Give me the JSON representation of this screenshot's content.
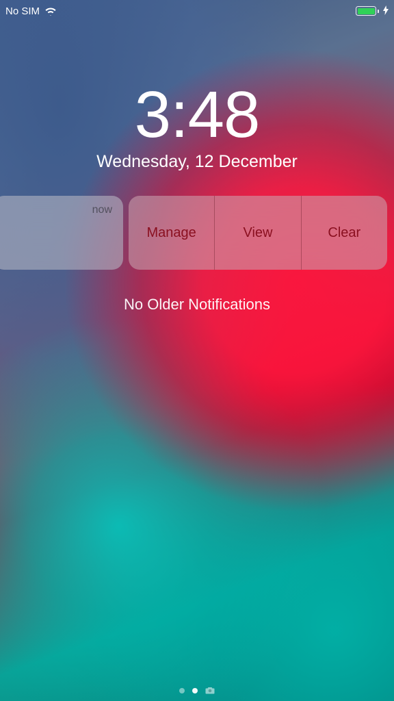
{
  "status_bar": {
    "carrier": "No SIM"
  },
  "clock": {
    "time": "3:48",
    "date": "Wednesday, 12 December"
  },
  "notification": {
    "timestamp": "now",
    "actions": {
      "manage": "Manage",
      "view": "View",
      "clear": "Clear"
    }
  },
  "empty_state": "No Older Notifications",
  "colors": {
    "battery_fill": "#30d158",
    "action_text": "#8a1020"
  }
}
